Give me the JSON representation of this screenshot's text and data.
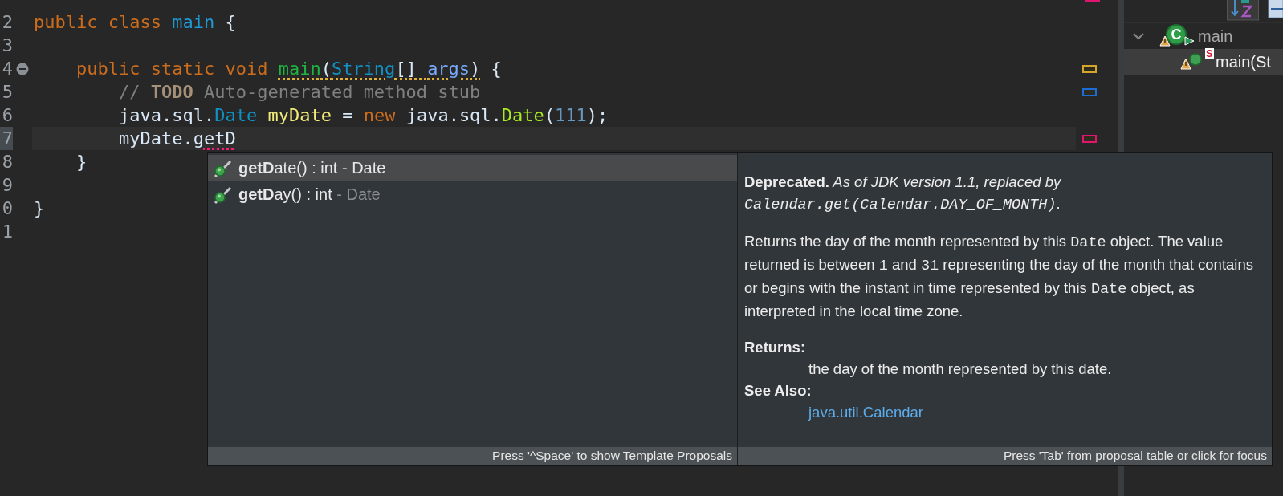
{
  "editor": {
    "lines": [
      {
        "number": "2",
        "current": false,
        "fold": false,
        "tokens": [
          {
            "text": "public class ",
            "kind": "keyword"
          },
          {
            "text": "main",
            "kind": "class-decl"
          },
          {
            "text": " {",
            "kind": "plain"
          }
        ]
      },
      {
        "number": "3",
        "current": false,
        "fold": false
      },
      {
        "number": "4",
        "current": false,
        "fold": true,
        "marker": {
          "color": "#d4a72c"
        },
        "tokens": [
          {
            "text": "    public static void ",
            "kind": "keyword"
          },
          {
            "text": "main",
            "kind": "method-decl",
            "underline": {
              "color": "#e0b23a"
            }
          },
          {
            "text": "(",
            "kind": "plain",
            "underline": {
              "color": "#e0b23a"
            }
          },
          {
            "text": "String",
            "kind": "type",
            "underline": {
              "color": "#e0b23a"
            }
          },
          {
            "text": "[] ",
            "kind": "plain",
            "underline": {
              "color": "#e0b23a"
            }
          },
          {
            "text": "args",
            "kind": "param",
            "underline": {
              "color": "#e0b23a"
            }
          },
          {
            "text": ")",
            "kind": "plain",
            "underline": {
              "color": "#e0b23a"
            }
          },
          {
            "text": " {",
            "kind": "plain"
          }
        ]
      },
      {
        "number": "5",
        "current": false,
        "fold": false,
        "marker": {
          "color": "#1c6ed6"
        },
        "tokens": [
          {
            "text": "        // ",
            "kind": "comment"
          },
          {
            "text": "TODO",
            "kind": "todo"
          },
          {
            "text": " Auto-generated method stub",
            "kind": "comment"
          }
        ]
      },
      {
        "number": "6",
        "current": false,
        "fold": false,
        "tokens": [
          {
            "text": "        java.sql.",
            "kind": "plain"
          },
          {
            "text": "Date ",
            "kind": "type"
          },
          {
            "text": "myDate",
            "kind": "variable"
          },
          {
            "text": " = ",
            "kind": "plain"
          },
          {
            "text": "new",
            "kind": "keyword"
          },
          {
            "text": " java.sql.",
            "kind": "plain"
          },
          {
            "text": "Date",
            "kind": "constructor"
          },
          {
            "text": "(",
            "kind": "plain"
          },
          {
            "text": "111",
            "kind": "number"
          },
          {
            "text": ");",
            "kind": "plain"
          }
        ]
      },
      {
        "number": "7",
        "current": true,
        "fold": false,
        "marker": {
          "color": "#e0166e"
        },
        "tokens": [
          {
            "text": "        myDate.",
            "kind": "plain"
          },
          {
            "text": "getD",
            "kind": "plain",
            "underline": {
              "color": "#ff1a7a"
            }
          }
        ]
      },
      {
        "number": "8",
        "current": false,
        "fold": false,
        "tokens": [
          {
            "text": "    }",
            "kind": "plain"
          }
        ]
      },
      {
        "number": "9",
        "current": false,
        "fold": false
      },
      {
        "number": "0",
        "current": false,
        "fold": false,
        "tokens": [
          {
            "text": "}",
            "kind": "plain"
          }
        ]
      },
      {
        "number": "1",
        "current": false,
        "fold": false
      }
    ],
    "top_marker": {
      "color": "#e0166e"
    }
  },
  "completion": {
    "proposals": [
      {
        "label": "**getD**ate() : int",
        "qualifier": "- Date",
        "selected": true
      },
      {
        "label": "**getD**ay() : int",
        "qualifier": "- Date",
        "selected": false
      }
    ],
    "proposals_footer": "Press '^Space' to show Template Proposals",
    "doc": {
      "paragraphs": [
        [
          {
            "text": "Deprecated.",
            "kind": "bold"
          },
          {
            "text": " As of JDK version 1.1, replaced by ",
            "kind": "italic"
          },
          {
            "text": "Calendar.get(Calendar.DAY_OF_MONTH)",
            "kind": "code-italic"
          },
          {
            "text": ".",
            "kind": "plain"
          }
        ],
        [
          {
            "text": "Returns the day of the month represented by this ",
            "kind": "plain"
          },
          {
            "text": "Date",
            "kind": "code"
          },
          {
            "text": " object. The value returned is between ",
            "kind": "plain"
          },
          {
            "text": "1",
            "kind": "code"
          },
          {
            "text": " and ",
            "kind": "plain"
          },
          {
            "text": "31",
            "kind": "code"
          },
          {
            "text": " representing the day of the month that contains or begins with the instant in time represented by this ",
            "kind": "plain"
          },
          {
            "text": "Date",
            "kind": "code"
          },
          {
            "text": " object, as interpreted in the local time zone.",
            "kind": "plain"
          }
        ]
      ],
      "returns_heading": "Returns:",
      "returns_text": "the day of the month represented by this date.",
      "see_also_heading": "See Also:",
      "see_also_link": "java.util.Calendar"
    },
    "doc_footer": "Press 'Tab' from proposal table or click for focus"
  },
  "outline": {
    "items": [
      {
        "label": "main",
        "kind": "class",
        "icon_letter": "C",
        "expanded": true,
        "selected": false
      },
      {
        "label": "main(St",
        "kind": "method",
        "icon_letter": "S",
        "selected": true
      }
    ]
  }
}
